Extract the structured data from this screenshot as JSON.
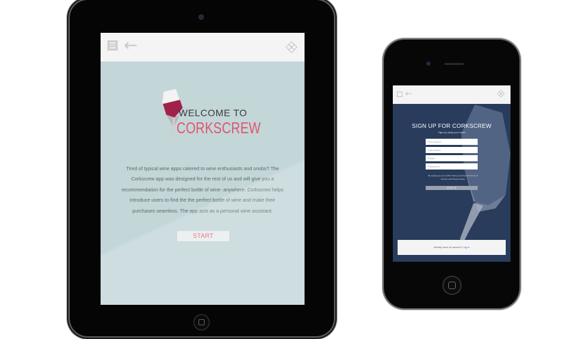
{
  "tablet_app": {
    "welcome_text": "WELCOME TO",
    "brand": "CORKSCREW",
    "description": "Tired of typical wine apps catered to wine enthusiasts and snobs? The Corkscrew app was designed for the rest of us and will give you a recommendation for the perfect bottle of wine- anywhere. Corkscrew helps introduce users to find the the perfect bottle of wine and make their purchases seamless. The app acts as a personal wine assistant.",
    "start_label": "START",
    "icons": {
      "menu": "menu-icon",
      "back": "back-arrow-icon",
      "navigation": "dpad-icon",
      "logo": "wine-glass-icon"
    }
  },
  "phone_app": {
    "title": "SIGN UP FOR CORKSCREW",
    "subtitle": "Sign up using your email",
    "fields": [
      {
        "placeholder": "First Name"
      },
      {
        "placeholder": "Last Name"
      },
      {
        "placeholder": "Email"
      },
      {
        "placeholder": "Password"
      }
    ],
    "terms_text": "By signing up you confirm that you accept the Terms of Service and Privacy Policy",
    "signup_label": "SIGN UP",
    "login_prompt": "Already have an account?",
    "login_link": "Log In",
    "icons": {
      "menu": "menu-icon",
      "back": "back-arrow-icon",
      "navigation": "dpad-icon"
    }
  },
  "colors": {
    "tablet_background": "#c3d6d8",
    "phone_background": "#293c5c",
    "brand_accent": "#e0556e",
    "wine": "#a0224a",
    "topbar": "#f4f4f4"
  }
}
